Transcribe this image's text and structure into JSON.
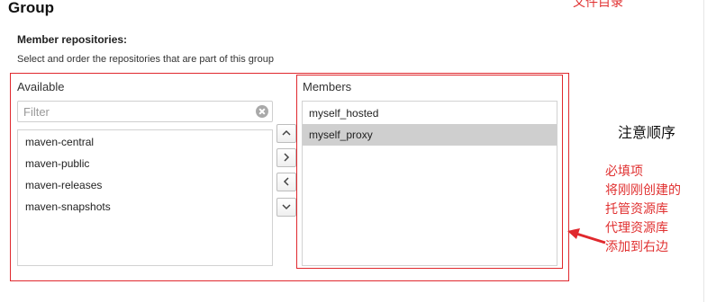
{
  "header": {
    "title": "Group",
    "annotation_top": "文件目录"
  },
  "members_field": {
    "label": "Member repositories:",
    "help": "Select and order the repositories that are part of this group"
  },
  "available": {
    "title": "Available",
    "filter_placeholder": "Filter",
    "items": [
      "maven-central",
      "maven-public",
      "maven-releases",
      "maven-snapshots"
    ]
  },
  "controls": {
    "icons": [
      "chevron-up-icon",
      "chevron-right-icon",
      "chevron-left-icon",
      "chevron-down-icon"
    ]
  },
  "members": {
    "title": "Members",
    "items": [
      "myself_hosted",
      "myself_proxy"
    ],
    "selected_index": 1
  },
  "annotations": {
    "order_note": "注意顺序",
    "required_note": [
      "必填项",
      "将刚刚创建的",
      "托管资源库",
      "代理资源库",
      "添加到右边"
    ],
    "annotation_color": "#e03030"
  }
}
